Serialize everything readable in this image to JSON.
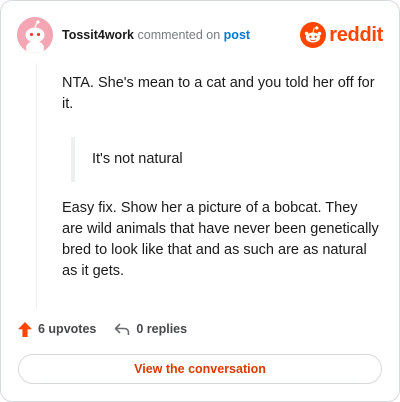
{
  "comment": {
    "author": "Tossit4work",
    "verb": "commented on",
    "target_link": "post",
    "paragraphs": {
      "first": "NTA. She's mean to a cat and you told her off for it.",
      "quote": "It's not natural",
      "second": "Easy fix. Show her a picture of a bobcat. They are wild animals that have never been genetically bred to look like that and as such are as natural as it gets."
    }
  },
  "brand": {
    "wordmark": "reddit",
    "icon": "reddit-snoo-icon",
    "color": "#ff4500"
  },
  "actions": {
    "upvotes_label": "6 upvotes",
    "replies_label": "0 replies",
    "upvote_icon": "upvote-arrow-icon",
    "reply_icon": "reply-arrow-icon",
    "upvote_color": "#ff4500"
  },
  "cta": {
    "label": "View the conversation"
  },
  "colors": {
    "link": "#0079d3",
    "cta_text": "#d93a00",
    "avatar_bg": "#f4a6b4"
  }
}
